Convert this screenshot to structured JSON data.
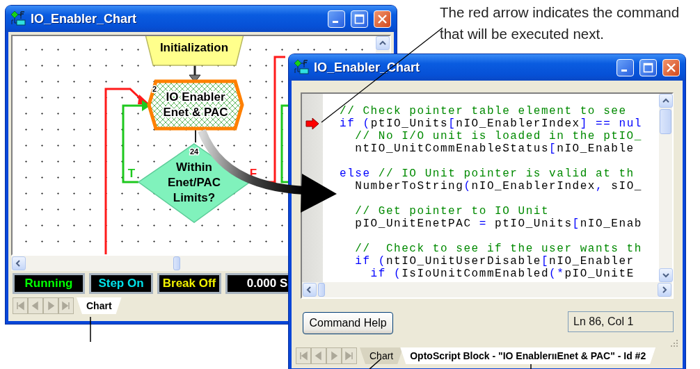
{
  "annotation": {
    "text": "The red arrow indicates the command that will be executed next."
  },
  "chart_window": {
    "title": "IO_Enabler_Chart",
    "flowchart": {
      "nodes": [
        {
          "kind": "action",
          "lines": [
            "Initialization"
          ]
        },
        {
          "kind": "script",
          "number": "2",
          "lines": [
            "IO Enabler",
            "Enet & PAC"
          ]
        },
        {
          "kind": "condition",
          "number": "24",
          "lines": [
            "Within",
            "Enet/PAC",
            "Limits?"
          ]
        }
      ],
      "branch_labels": [
        {
          "kind": "true",
          "text": "T"
        },
        {
          "kind": "false",
          "text": "F"
        }
      ]
    },
    "status_bar": [
      {
        "kind": "run_state",
        "text": "Running"
      },
      {
        "kind": "step_mode",
        "text": "Step On"
      },
      {
        "kind": "break_mode",
        "text": "Break Off"
      },
      {
        "kind": "timer",
        "text": "0.000 S"
      }
    ],
    "tabs": [
      {
        "label": "Chart",
        "selected": true
      }
    ]
  },
  "script_window": {
    "title": "IO_Enabler_Chart",
    "lines": [
      {
        "kind": "code",
        "next": false,
        "tokens": [
          {
            "kind": "comment",
            "text": "// Check pointer table element to see"
          }
        ]
      },
      {
        "kind": "code",
        "next": true,
        "tokens": [
          {
            "kind": "keyword",
            "text": "if "
          },
          {
            "kind": "symbol",
            "text": "("
          },
          {
            "kind": "plain",
            "text": "ptIO_Units"
          },
          {
            "kind": "symbol",
            "text": "["
          },
          {
            "kind": "plain",
            "text": "nIO_EnablerIndex"
          },
          {
            "kind": "symbol",
            "text": "] == "
          },
          {
            "kind": "keyword",
            "text": "nul"
          }
        ]
      },
      {
        "kind": "code",
        "next": false,
        "tokens": [
          {
            "kind": "comment",
            "text": "  // No I/O unit is loaded in the ptIO_"
          }
        ]
      },
      {
        "kind": "code",
        "next": false,
        "tokens": [
          {
            "kind": "plain",
            "text": "  ntIO_UnitCommEnableStatus"
          },
          {
            "kind": "symbol",
            "text": "["
          },
          {
            "kind": "plain",
            "text": "nIO_Enable"
          }
        ]
      },
      {
        "kind": "blank",
        "next": false
      },
      {
        "kind": "code",
        "next": false,
        "tokens": [
          {
            "kind": "keyword",
            "text": "else "
          },
          {
            "kind": "comment",
            "text": "// IO Unit pointer is valid at th"
          }
        ]
      },
      {
        "kind": "code",
        "next": false,
        "tokens": [
          {
            "kind": "plain",
            "text": "  NumberToString"
          },
          {
            "kind": "symbol",
            "text": "("
          },
          {
            "kind": "plain",
            "text": "nIO_EnablerIndex"
          },
          {
            "kind": "symbol",
            "text": ","
          },
          {
            "kind": "plain",
            "text": " sIO_"
          }
        ]
      },
      {
        "kind": "blank",
        "next": false
      },
      {
        "kind": "code",
        "next": false,
        "tokens": [
          {
            "kind": "comment",
            "text": "  // Get pointer to IO Unit"
          }
        ]
      },
      {
        "kind": "code",
        "next": false,
        "tokens": [
          {
            "kind": "plain",
            "text": "  pIO_UnitEnetPAC "
          },
          {
            "kind": "symbol",
            "text": "="
          },
          {
            "kind": "plain",
            "text": " ptIO_Units"
          },
          {
            "kind": "symbol",
            "text": "["
          },
          {
            "kind": "plain",
            "text": "nIO_Enab"
          }
        ]
      },
      {
        "kind": "blank",
        "next": false
      },
      {
        "kind": "code",
        "next": false,
        "tokens": [
          {
            "kind": "comment",
            "text": "  //  Check to see if the user wants th"
          }
        ]
      },
      {
        "kind": "code",
        "next": false,
        "tokens": [
          {
            "kind": "keyword",
            "text": "  if "
          },
          {
            "kind": "symbol",
            "text": "("
          },
          {
            "kind": "plain",
            "text": "ntIO_UnitUserDisable"
          },
          {
            "kind": "symbol",
            "text": "["
          },
          {
            "kind": "plain",
            "text": "nIO_Enabler"
          }
        ]
      },
      {
        "kind": "code",
        "next": false,
        "tokens": [
          {
            "kind": "keyword",
            "text": "    if "
          },
          {
            "kind": "symbol",
            "text": "("
          },
          {
            "kind": "plain",
            "text": "IsIoUnitCommEnabled"
          },
          {
            "kind": "symbol",
            "text": "(*"
          },
          {
            "kind": "plain",
            "text": "pIO_UnitE"
          }
        ]
      }
    ],
    "button": "Command Help",
    "position": "Ln 86, Col 1",
    "tabs": [
      {
        "label": "Chart",
        "selected": false
      },
      {
        "label": "OptoScript Block - \"IO EnablerııEnet & PAC\" - Id #2",
        "selected": true
      }
    ]
  }
}
